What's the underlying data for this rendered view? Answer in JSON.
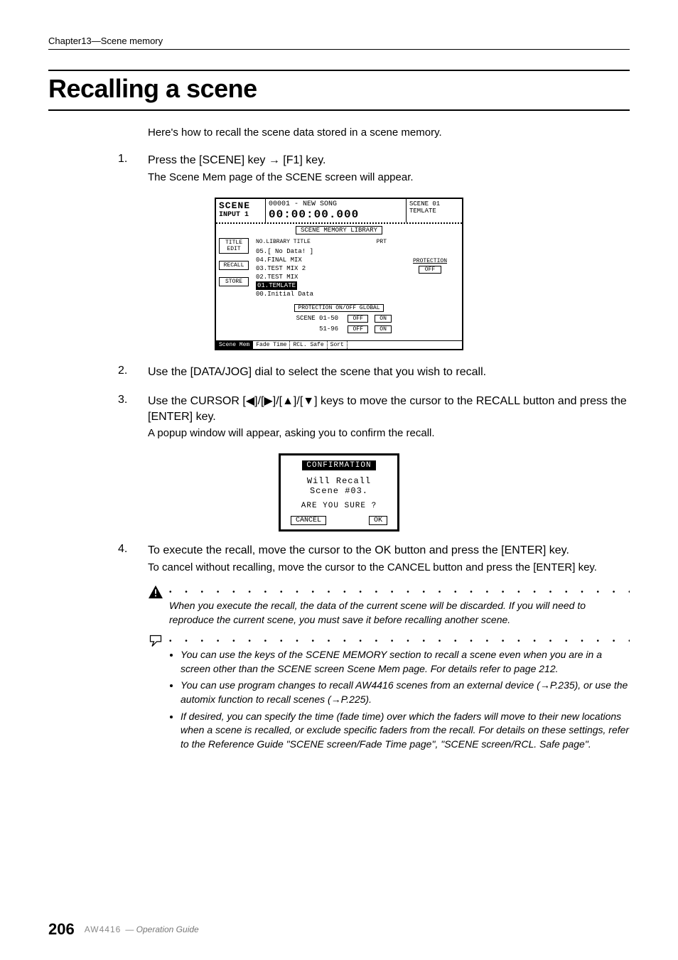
{
  "header": {
    "chapter": "Chapter13—Scene memory"
  },
  "title": "Recalling a scene",
  "intro": "Here's how to recall the scene data stored in a scene memory.",
  "steps": [
    {
      "num": "1.",
      "title": "Press the [SCENE] key → [F1] key.",
      "desc": "The Scene Mem page of the SCENE screen will appear."
    },
    {
      "num": "2.",
      "title": "Use the [DATA/JOG] dial to select the scene that you wish to recall.",
      "desc": ""
    },
    {
      "num": "3.",
      "title": "Use the CURSOR [◀]/[▶]/[▲]/[▼] keys to move the cursor to the RECALL button and press the [ENTER] key.",
      "desc": "A popup window will appear, asking you to confirm the recall."
    },
    {
      "num": "4.",
      "title": "To execute the recall, move the cursor to the OK button and press the [ENTER] key.",
      "desc": "To cancel without recalling, move the cursor to the CANCEL button and press the [ENTER] key."
    }
  ],
  "lcd": {
    "screen_name": "SCENE",
    "screen_sub": "INPUT 1",
    "song_id": "00001 - NEW SONG",
    "timecode": "00:00:00.000",
    "scene_no": "SCENE 01",
    "scene_name": "TEMLATE",
    "library_title": "SCENE MEMORY LIBRARY",
    "list_header_no": "NO.LIBRARY TITLE",
    "list_header_prt": "PRT",
    "items": [
      "05.[   No Data!   ]",
      "04.FINAL MIX",
      "03.TEST MIX 2",
      "02.TEST MIX"
    ],
    "selected": "01.TEMLATE",
    "initial": "00.Initial Data",
    "side_buttons": {
      "title_edit": "TITLE\nEDIT",
      "recall": "RECALL",
      "store": "STORE"
    },
    "protection": {
      "label": "PROTECTION",
      "value": "OFF"
    },
    "global": {
      "title": "PROTECTION ON/OFF GLOBAL",
      "rows": [
        {
          "range": "SCENE 01-50",
          "off": "OFF",
          "on": "ON"
        },
        {
          "range": "51-96",
          "off": "OFF",
          "on": "ON"
        }
      ]
    },
    "tabs": [
      "Scene Mem",
      "Fade Time",
      "RCL. Safe",
      "Sort"
    ]
  },
  "popup": {
    "title": "CONFIRMATION",
    "line1": "Will Recall",
    "line2": "Scene #03.",
    "question": "ARE YOU SURE ?",
    "cancel": "CANCEL",
    "ok": "OK"
  },
  "warning": "When you execute the recall, the data of the current scene will be discarded. If you will need to reproduce the current scene, you must save it before recalling another scene.",
  "tips": [
    "You can use the keys of the SCENE MEMORY section to recall a scene even when you are in a screen other than the SCENE screen Scene Mem page. For details refer to page 212.",
    "You can use program changes to recall AW4416 scenes from an external device (→P.235), or use the automix function to recall scenes (→P.225).",
    "If desired, you can specify the time (fade time) over which the faders will move to their new locations when a scene is recalled, or exclude specific faders from the recall. For details on these settings, refer to the Reference Guide \"SCENE screen/Fade Time page\", \"SCENE screen/RCL. Safe page\"."
  ],
  "footer": {
    "page": "206",
    "model": "AW4416",
    "guide": "— Operation Guide"
  }
}
